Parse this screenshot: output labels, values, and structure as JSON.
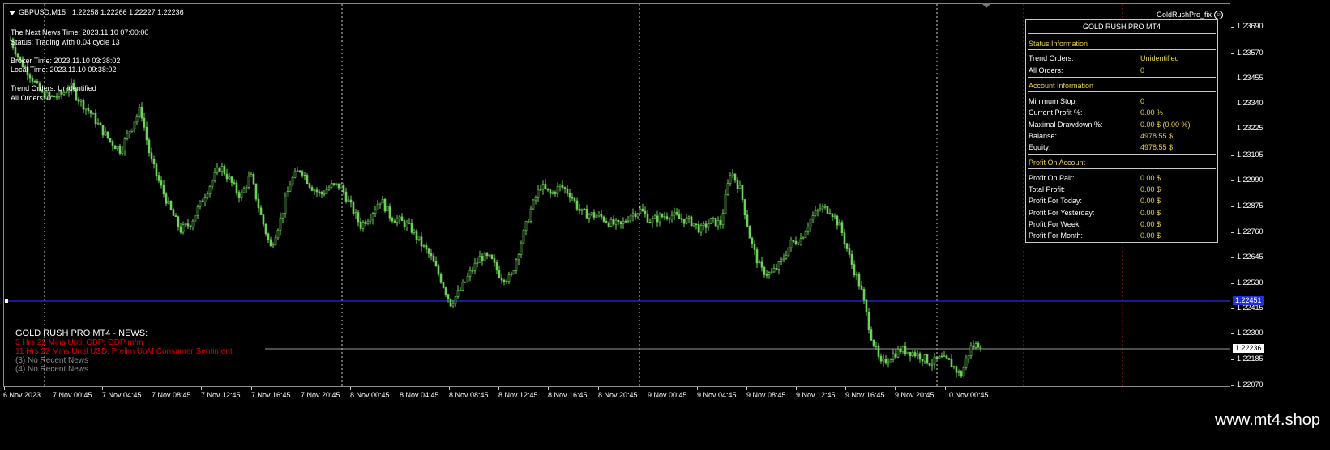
{
  "header": {
    "symbol": "GBPUSD,M15",
    "ohlc": "1.22258 1.22266 1.22227 1.22236",
    "ea_name": "GoldRushPro_fix"
  },
  "info": {
    "next_news": "The Next News Time: 2023.11.10 07:00:00",
    "status": "Status: Trading with 0.04 cycle 13",
    "broker_time": "Broker Time: 2023.11.10 03:38:02",
    "local_time": "Local Time: 2023.11.10 09:38:02",
    "trend_orders": "Trend Orders: Unidentified",
    "all_orders": "All Orders: 0"
  },
  "panel": {
    "title": "GOLD RUSH PRO MT4",
    "status_header": "Status Information",
    "status_rows": [
      {
        "label": "Trend Orders:",
        "value": "Unidentified"
      },
      {
        "label": "All Orders:",
        "value": "0"
      }
    ],
    "account_header": "Account Information",
    "account_rows": [
      {
        "label": "Minimum Stop:",
        "value": "0"
      },
      {
        "label": "Current Profit %:",
        "value": "0.00 %"
      },
      {
        "label": "Maximal Drawdown %:",
        "value": "0.00 $ (0.00 %)"
      },
      {
        "label": "Balanse:",
        "value": "4978.55 $"
      },
      {
        "label": "Equity:",
        "value": "4978.55 $"
      }
    ],
    "profit_header": "Profit On Account",
    "profit_rows": [
      {
        "label": "Profit On Pair:",
        "value": "0.00 $"
      },
      {
        "label": "Total Profit:",
        "value": "0.00 $"
      },
      {
        "label": "Profit For Today:",
        "value": "0.00 $"
      },
      {
        "label": "Profit For Yesterday:",
        "value": "0.00 $"
      },
      {
        "label": "Profit For Week:",
        "value": "0.00 $"
      },
      {
        "label": "Profit For Month:",
        "value": "0.00 $"
      }
    ]
  },
  "news": {
    "title": "GOLD RUSH PRO MT4 - NEWS:",
    "items": [
      "3 Hrs 22 Mins Until GBP: GDP m/m",
      "11 Hrs 22 Mins Until USD: Prelim UoM Consumer Sentiment",
      "(3)  No Recent News",
      "(4)  No Recent News"
    ]
  },
  "price_axis": {
    "labels": [
      "1.23690",
      "1.23570",
      "1.23455",
      "1.23340",
      "1.23225",
      "1.23105",
      "1.22990",
      "1.22875",
      "1.22760",
      "1.22645",
      "1.22530",
      "1.22415",
      "1.22300",
      "1.22185",
      "1.22070"
    ],
    "hline_tag": "1.22451",
    "bid_tag": "1.22236"
  },
  "time_axis": {
    "labels": [
      "6 Nov 2023",
      "7 Nov 00:45",
      "7 Nov 04:45",
      "7 Nov 08:45",
      "7 Nov 12:45",
      "7 Nov 16:45",
      "7 Nov 20:45",
      "8 Nov 00:45",
      "8 Nov 04:45",
      "8 Nov 08:45",
      "8 Nov 12:45",
      "8 Nov 16:45",
      "8 Nov 20:45",
      "9 Nov 00:45",
      "9 Nov 04:45",
      "9 Nov 08:45",
      "9 Nov 12:45",
      "9 Nov 16:45",
      "9 Nov 20:45",
      "10 Nov 00:45"
    ]
  },
  "footer": {
    "watermark": "www.mt4.shop"
  },
  "colors": {
    "candle": "#6fd35a",
    "hline": "#1f2fe0",
    "bid_line": "#9a9a9a",
    "panel_value": "#e8d14a",
    "news_red": "#e00000",
    "vline_red": "#b01818"
  },
  "chart_data": {
    "type": "line",
    "title": "",
    "series": [
      {
        "values": [
          1.2362,
          1.2352,
          1.2346,
          1.2338,
          1.2336,
          1.2337,
          1.2341,
          1.2334,
          1.2329,
          1.2322,
          1.2316,
          1.2312,
          1.2322,
          1.2331,
          1.2308,
          1.2296,
          1.2285,
          1.2276,
          1.2279,
          1.2288,
          1.2297,
          1.2305,
          1.2298,
          1.2291,
          1.2301,
          1.2283,
          1.2268,
          1.2281,
          1.2298,
          1.2304,
          1.2296,
          1.2292,
          1.2296,
          1.2296,
          1.2287,
          1.2278,
          1.2283,
          1.229,
          1.2282,
          1.228,
          1.2277,
          1.227,
          1.2264,
          1.2254,
          1.2243,
          1.2249,
          1.2257,
          1.2264,
          1.2263,
          1.2255,
          1.2254,
          1.227,
          1.2285,
          1.2296,
          1.2292,
          1.2296,
          1.2292,
          1.2284,
          1.2283,
          1.2282,
          1.2279,
          1.2278,
          1.2283,
          1.2285,
          1.228,
          1.2282,
          1.2283,
          1.2281,
          1.228,
          1.2276,
          1.228,
          1.2279,
          1.2303,
          1.2294,
          1.2271,
          1.2258,
          1.2256,
          1.2261,
          1.227,
          1.2272,
          1.2281,
          1.2286,
          1.2285,
          1.2277,
          1.2262,
          1.225,
          1.2229,
          1.2215,
          1.2219,
          1.2222,
          1.2221,
          1.2219,
          1.2216,
          1.2218,
          1.2216,
          1.221,
          1.2223,
          1.2225
        ]
      }
    ],
    "ylim": [
      1.2207,
      1.2369
    ],
    "grid": false
  }
}
